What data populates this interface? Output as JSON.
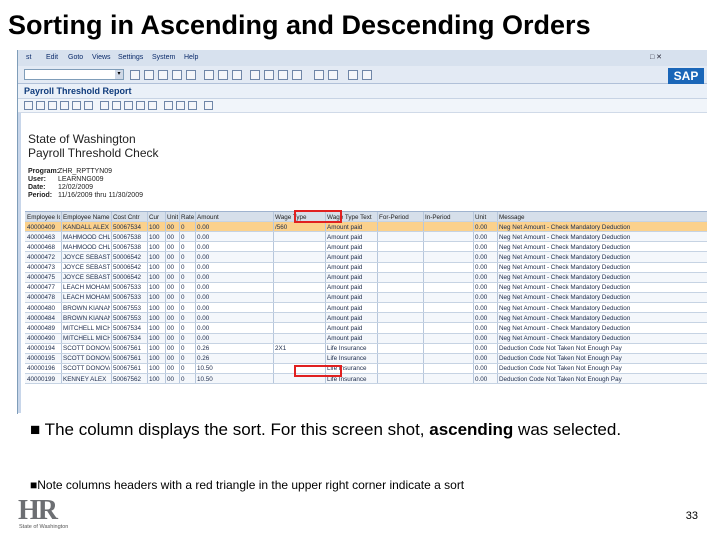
{
  "slide": {
    "title": "Sorting in Ascending and Descending Orders",
    "bullet1_pre": "■ The column displays the sort.  For this screen shot, ",
    "bullet1_bold": "ascending",
    "bullet1_post": " was selected.",
    "bullet2": "■Note columns headers with a red triangle in the upper right corner  indicate a sort",
    "page_number": "33",
    "logo_letters": "HR",
    "logo_tag": "State of Washington"
  },
  "sap": {
    "menu": [
      "st",
      "Edit",
      "Goto",
      "Views",
      "Settings",
      "System",
      "Help"
    ],
    "window_controls": "□ ✕",
    "brand": "SAP",
    "title": "Payroll Threshold Report",
    "report_title": "State of Washington",
    "report_subtitle": "Payroll Threshold Check",
    "meta": [
      {
        "label": "Program:",
        "value": "ZHR_RPTTYN09"
      },
      {
        "label": "User:",
        "value": "LEARNNG009"
      },
      {
        "label": "Date:",
        "value": "12/02/2009"
      },
      {
        "label": "Period:",
        "value": "11/16/2009 thru 11/30/2009"
      }
    ],
    "columns": [
      "Employee Id",
      "Employee Name",
      "Cost Cntr",
      "Cur",
      "Unit",
      "Rate",
      "Amount",
      "Wage Type",
      "Wage Type Text",
      "For-Period",
      "In-Period",
      "Unit",
      "Message"
    ],
    "rows": [
      [
        "40000409",
        "KANDALL ALEX",
        "50067534",
        "100",
        "00",
        "0",
        "0.00",
        "/560",
        "Amount paid",
        "",
        "",
        "0.00",
        "Neg Net Amount - Check Mandatory Deduction"
      ],
      [
        "40000463",
        "MAHMOOD CHLOE",
        "50067538",
        "100",
        "00",
        "0",
        "0.00",
        "",
        "Amount paid",
        "",
        "",
        "0.00",
        "Neg Net Amount - Check Mandatory Deduction"
      ],
      [
        "40000468",
        "MAHMOOD CHLOE",
        "50067538",
        "100",
        "00",
        "0",
        "0.00",
        "",
        "Amount paid",
        "",
        "",
        "0.00",
        "Neg Net Amount - Check Mandatory Deduction"
      ],
      [
        "40000472",
        "JOYCE SEBASTIAN",
        "50006542",
        "100",
        "00",
        "0",
        "0.00",
        "",
        "Amount paid",
        "",
        "",
        "0.00",
        "Neg Net Amount - Check Mandatory Deduction"
      ],
      [
        "40000473",
        "JOYCE SEBASTIAN",
        "50006542",
        "100",
        "00",
        "0",
        "0.00",
        "",
        "Amount paid",
        "",
        "",
        "0.00",
        "Neg Net Amount - Check Mandatory Deduction"
      ],
      [
        "40000475",
        "JOYCE SEBASTIAN",
        "50006542",
        "100",
        "00",
        "0",
        "0.00",
        "",
        "Amount paid",
        "",
        "",
        "0.00",
        "Neg Net Amount - Check Mandatory Deduction"
      ],
      [
        "40000477",
        "LEACH MOHAMMED",
        "50067533",
        "100",
        "00",
        "0",
        "0.00",
        "",
        "Amount paid",
        "",
        "",
        "0.00",
        "Neg Net Amount - Check Mandatory Deduction"
      ],
      [
        "40000478",
        "LEACH MOHAMMED",
        "50067533",
        "100",
        "00",
        "0",
        "0.00",
        "",
        "Amount paid",
        "",
        "",
        "0.00",
        "Neg Net Amount - Check Mandatory Deduction"
      ],
      [
        "40000480",
        "BROWN KIANAN",
        "50067553",
        "100",
        "00",
        "0",
        "0.00",
        "",
        "Amount paid",
        "",
        "",
        "0.00",
        "Neg Net Amount - Check Mandatory Deduction"
      ],
      [
        "40000484",
        "BROWN KIANAN",
        "50067553",
        "100",
        "00",
        "0",
        "0.00",
        "",
        "Amount paid",
        "",
        "",
        "0.00",
        "Neg Net Amount - Check Mandatory Deduction"
      ],
      [
        "40000489",
        "MITCHELL MICHAEL",
        "50067534",
        "100",
        "00",
        "0",
        "0.00",
        "",
        "Amount paid",
        "",
        "",
        "0.00",
        "Neg Net Amount - Check Mandatory Deduction"
      ],
      [
        "40000490",
        "MITCHELL MICHAEL",
        "50067534",
        "100",
        "00",
        "0",
        "0.00",
        "",
        "Amount paid",
        "",
        "",
        "0.00",
        "Neg Net Amount - Check Mandatory Deduction"
      ],
      [
        "40000194",
        "SCOTT DONOVAN",
        "50067561",
        "100",
        "00",
        "0",
        "0.26",
        "2X1",
        "Life Insurance",
        "",
        "",
        "0.00",
        "Deduction Code Not Taken Not Enough Pay"
      ],
      [
        "40000195",
        "SCOTT DONOVAN",
        "50067561",
        "100",
        "00",
        "0",
        "0.26",
        "",
        "Life Insurance",
        "",
        "",
        "0.00",
        "Deduction Code Not Taken Not Enough Pay"
      ],
      [
        "40000196",
        "SCOTT DONOVAN",
        "50067561",
        "100",
        "00",
        "0",
        "10.50",
        "",
        "Life Insurance",
        "",
        "",
        "0.00",
        "Deduction Code Not Taken Not Enough Pay"
      ],
      [
        "40000199",
        "KENNEY ALEX",
        "50067562",
        "100",
        "00",
        "0",
        "10.50",
        "",
        "Life Insurance",
        "",
        "",
        "0.00",
        "Deduction Code Not Taken Not Enough Pay"
      ]
    ],
    "accent_red": "#e02020",
    "selected_row_color": "#fbd18c"
  }
}
